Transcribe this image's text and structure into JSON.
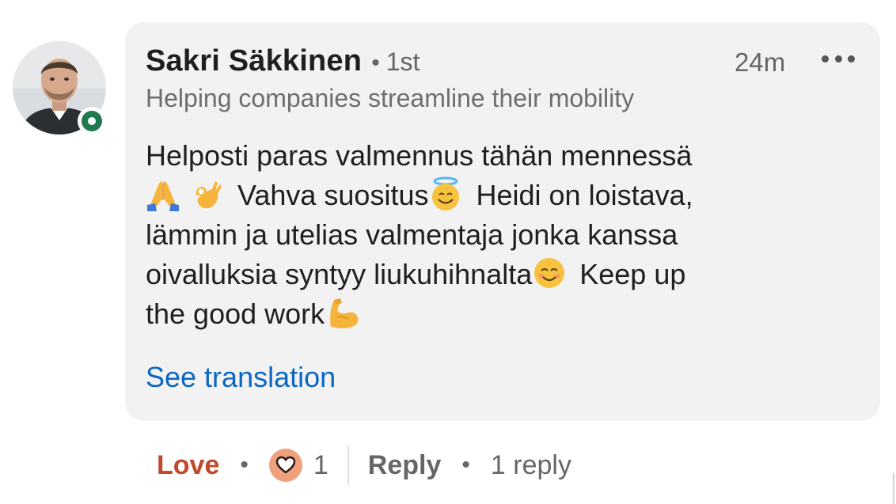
{
  "comment": {
    "author_name": "Sakri Säkkinen",
    "degree": "1st",
    "degree_separator": "•",
    "timestamp": "24m",
    "headline": "Helping companies streamline their mobility",
    "body_lines": [
      "Helposti paras valmennus tähän mennessä",
      "Vahva suositus",
      "Heidi on loistava,",
      "lämmin ja utelias valmentaja jonka kanssa",
      "oivalluksia syntyy liukuhihnalta",
      "Keep up",
      "the good work"
    ],
    "see_translation": "See translation",
    "online_status": "online"
  },
  "actions": {
    "love_label": "Love",
    "separator": "•",
    "reaction_count": "1",
    "reply_label": "Reply",
    "replies_count": "1 reply"
  },
  "colors": {
    "bubble_bg": "#f2f2f2",
    "link": "#0a66c2",
    "love": "#c0492b",
    "online": "#1f7a4d",
    "text": "#1f1f1f",
    "muted": "#666666"
  },
  "icons": [
    "avatar-photo",
    "online-status-icon",
    "more-options-icon",
    "folded-hands-emoji",
    "ok-hand-emoji",
    "smiling-face-with-halo-emoji",
    "smiling-face-emoji",
    "flexed-biceps-emoji",
    "heart-reaction-icon"
  ]
}
